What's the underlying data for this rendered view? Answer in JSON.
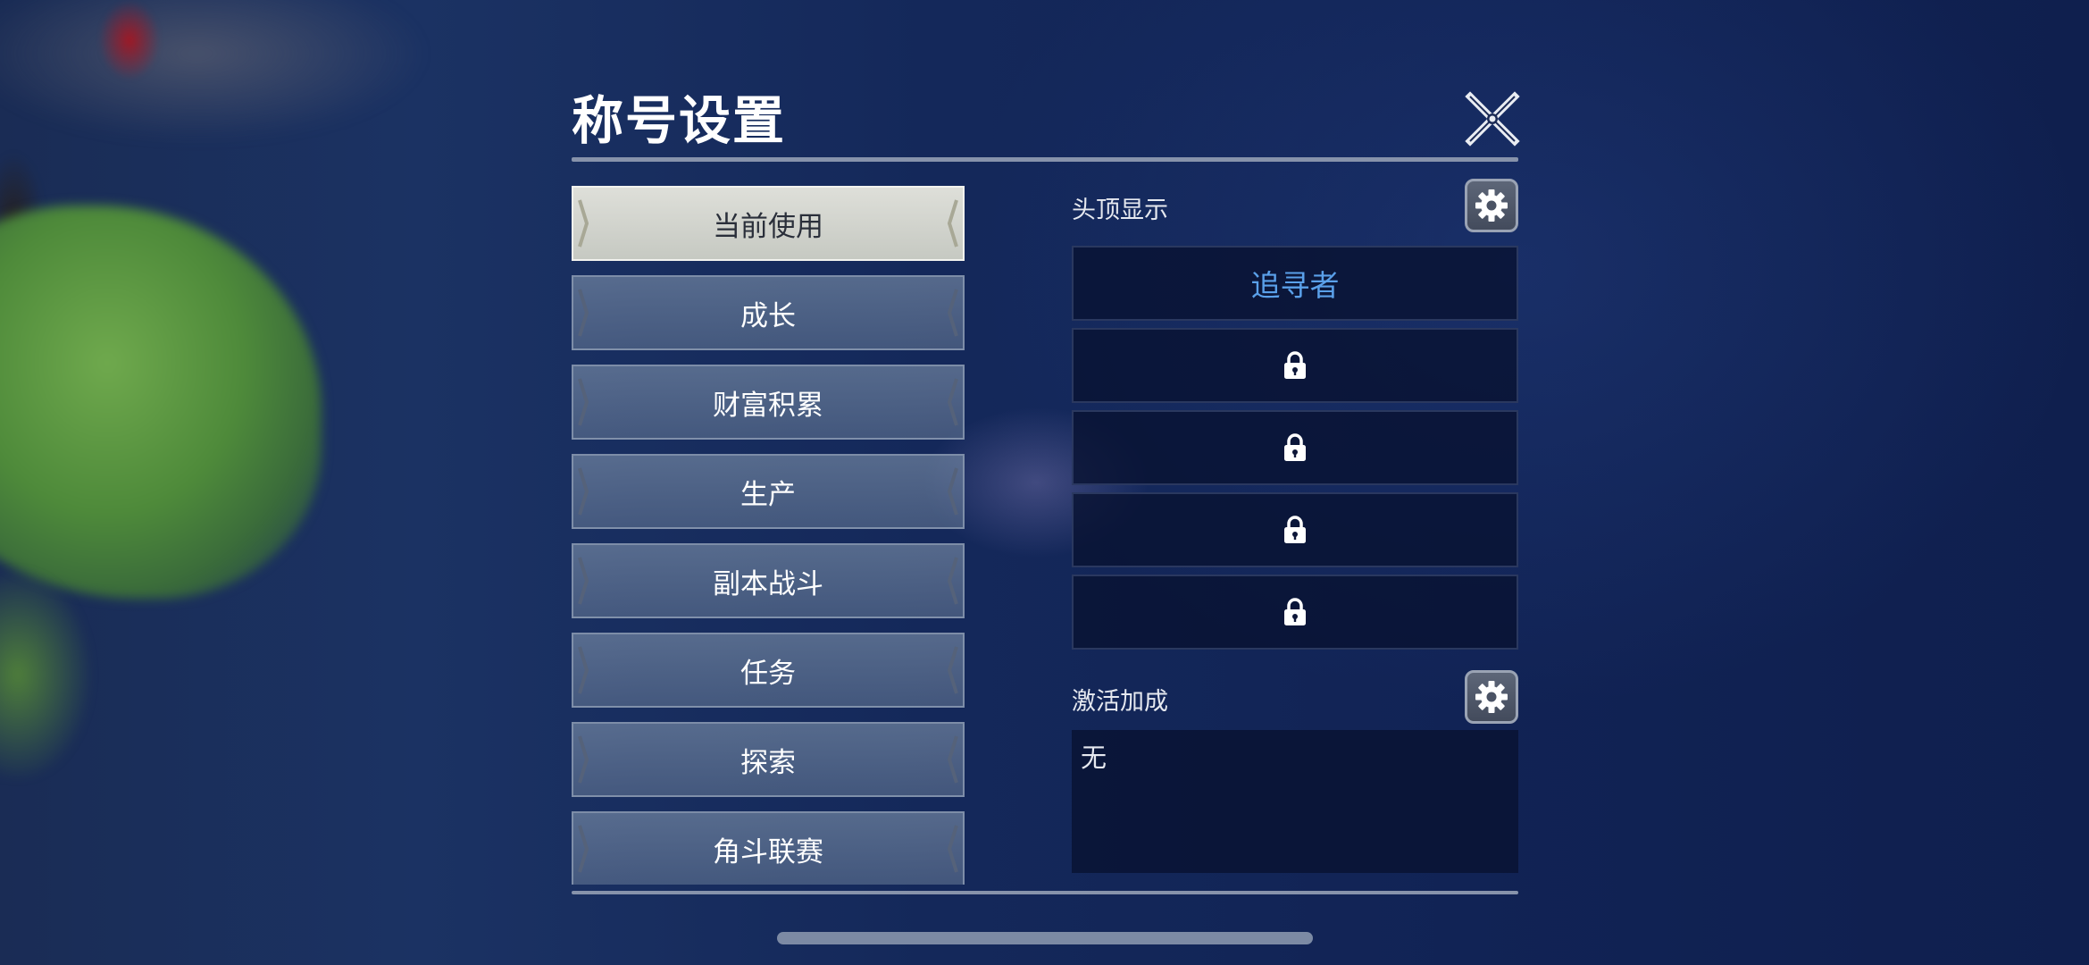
{
  "panel": {
    "title": "称号设置",
    "close_icon": "close-x-icon"
  },
  "categories": [
    {
      "label": "当前使用",
      "active": true
    },
    {
      "label": "成长",
      "active": false
    },
    {
      "label": "财富积累",
      "active": false
    },
    {
      "label": "生产",
      "active": false
    },
    {
      "label": "副本战斗",
      "active": false
    },
    {
      "label": "任务",
      "active": false
    },
    {
      "label": "探索",
      "active": false
    },
    {
      "label": "角斗联赛",
      "active": false
    }
  ],
  "head_display": {
    "label": "头顶显示",
    "settings_icon": "gear-icon",
    "slots": [
      {
        "text": "追寻者",
        "locked": false
      },
      {
        "text": "",
        "locked": true,
        "icon": "lock-icon"
      },
      {
        "text": "",
        "locked": true,
        "icon": "lock-icon"
      },
      {
        "text": "",
        "locked": true,
        "icon": "lock-icon"
      },
      {
        "text": "",
        "locked": true,
        "icon": "lock-icon"
      }
    ]
  },
  "activation_bonus": {
    "label": "激活加成",
    "settings_icon": "gear-icon",
    "value": "无"
  },
  "colors": {
    "title_accent": "#5aa0ea",
    "active_tab": "#d4d6cf"
  }
}
